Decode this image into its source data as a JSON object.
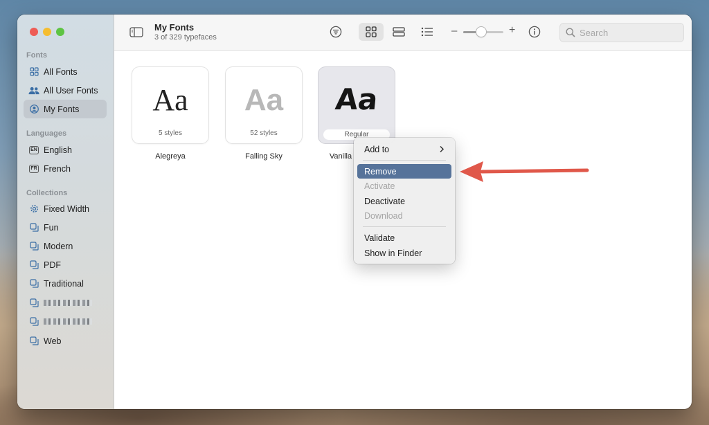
{
  "window": {
    "title": "My Fonts",
    "subtitle": "3 of 329 typefaces"
  },
  "sidebar": {
    "sections": [
      {
        "title": "Fonts",
        "items": [
          {
            "label": "All Fonts",
            "icon": "grid-icon"
          },
          {
            "label": "All User Fonts",
            "icon": "users-icon"
          },
          {
            "label": "My Fonts",
            "icon": "user-circle-icon",
            "selected": true
          }
        ]
      },
      {
        "title": "Languages",
        "items": [
          {
            "label": "English",
            "badge": "EN"
          },
          {
            "label": "French",
            "badge": "FR"
          }
        ]
      },
      {
        "title": "Collections",
        "items": [
          {
            "label": "Fixed Width",
            "icon": "gear-icon"
          },
          {
            "label": "Fun",
            "icon": "collection-icon"
          },
          {
            "label": "Modern",
            "icon": "collection-icon"
          },
          {
            "label": "PDF",
            "icon": "collection-icon"
          },
          {
            "label": "Traditional",
            "icon": "collection-icon"
          },
          {
            "label": "",
            "icon": "collection-icon",
            "redacted": true
          },
          {
            "label": "",
            "icon": "collection-icon",
            "redacted": true
          },
          {
            "label": "Web",
            "icon": "collection-icon"
          }
        ]
      }
    ]
  },
  "toolbar": {
    "search_placeholder": "Search",
    "zoom_minus": "–",
    "zoom_plus": "+",
    "zoom_level": 0.45
  },
  "fonts": [
    {
      "name": "Alegreya",
      "sample": "Aa",
      "styles": "5 styles",
      "color": "#222222"
    },
    {
      "name": "Falling Sky",
      "sample": "Aa",
      "styles": "52 styles",
      "color": "#b8b8b8"
    },
    {
      "name": "Vanilla",
      "sample": "Aa",
      "styles": "Regular",
      "color": "#151515",
      "selected": true
    }
  ],
  "context_menu": {
    "add_to": "Add to",
    "remove": "Remove",
    "activate": "Activate",
    "deactivate": "Deactivate",
    "download": "Download",
    "validate": "Validate",
    "show_in_finder": "Show in Finder"
  },
  "colors": {
    "highlight": "#56739a",
    "annotation_arrow": "#e0584a"
  }
}
